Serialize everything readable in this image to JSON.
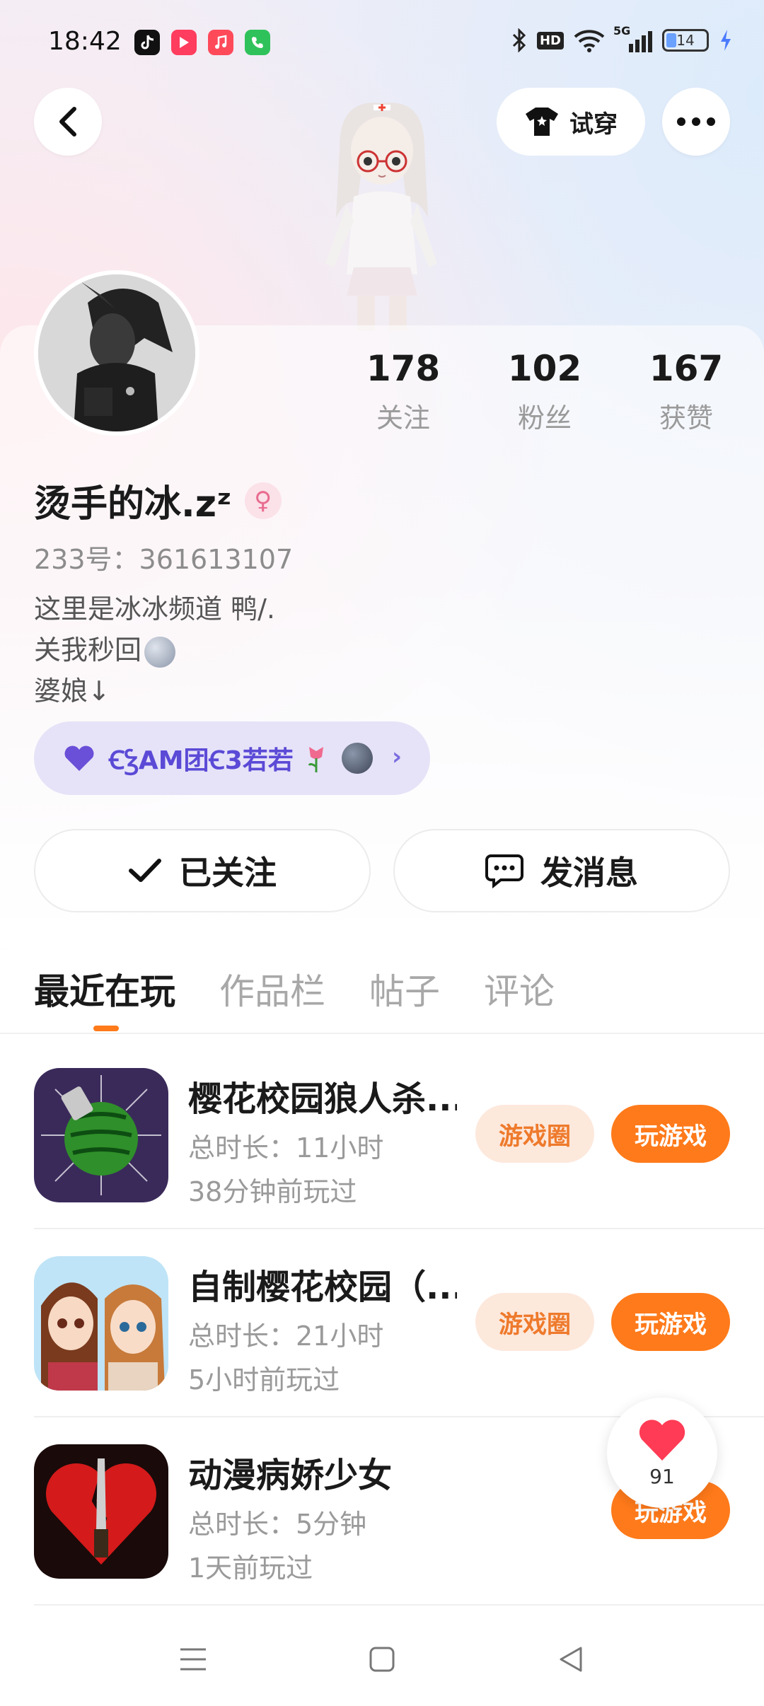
{
  "status_bar": {
    "time": "18:42",
    "apps": [
      "tiktok-icon",
      "video-icon",
      "music-icon",
      "phone-icon"
    ],
    "network": "5G",
    "hd": "HD",
    "battery": "14"
  },
  "header": {
    "try_on_label": "试穿"
  },
  "profile": {
    "stats": [
      {
        "count": "178",
        "label": "关注"
      },
      {
        "count": "102",
        "label": "粉丝"
      },
      {
        "count": "167",
        "label": "获赞"
      }
    ],
    "username": "烫手的冰.zᶻ",
    "gender": "female",
    "uid": "233号：361613107",
    "bio_lines": [
      "这里是冰冰频道 鸭/.",
      "关我秒回",
      "婆娘↓"
    ],
    "group_chip_label": "ꞒꝢAM团Ꞓ3若若"
  },
  "actions": {
    "follow_label": "已关注",
    "message_label": "发消息"
  },
  "tabs": [
    {
      "label": "最近在玩",
      "active": true
    },
    {
      "label": "作品栏",
      "active": false
    },
    {
      "label": "帖子",
      "active": false
    },
    {
      "label": "评论",
      "active": false
    }
  ],
  "games": [
    {
      "title": "樱花校园狼人杀...",
      "duration": "总时长：11小时",
      "last_played": "38分钟前玩过",
      "circle_label": "游戏圈",
      "play_label": "玩游戏"
    },
    {
      "title": "自制樱花校园（...",
      "duration": "总时长：21小时",
      "last_played": "5小时前玩过",
      "circle_label": "游戏圈",
      "play_label": "玩游戏"
    },
    {
      "title": "动漫病娇少女",
      "duration": "总时长：5分钟",
      "last_played": "1天前玩过",
      "play_label": "玩游戏"
    }
  ],
  "like_fab": {
    "count": "91"
  },
  "colors": {
    "accent_orange": "#ff7a1a",
    "circle_bg": "#fde8dc",
    "chip_bg": "#e6e3f8",
    "chip_text": "#5b4ad6",
    "heart": "#ff3b55"
  }
}
